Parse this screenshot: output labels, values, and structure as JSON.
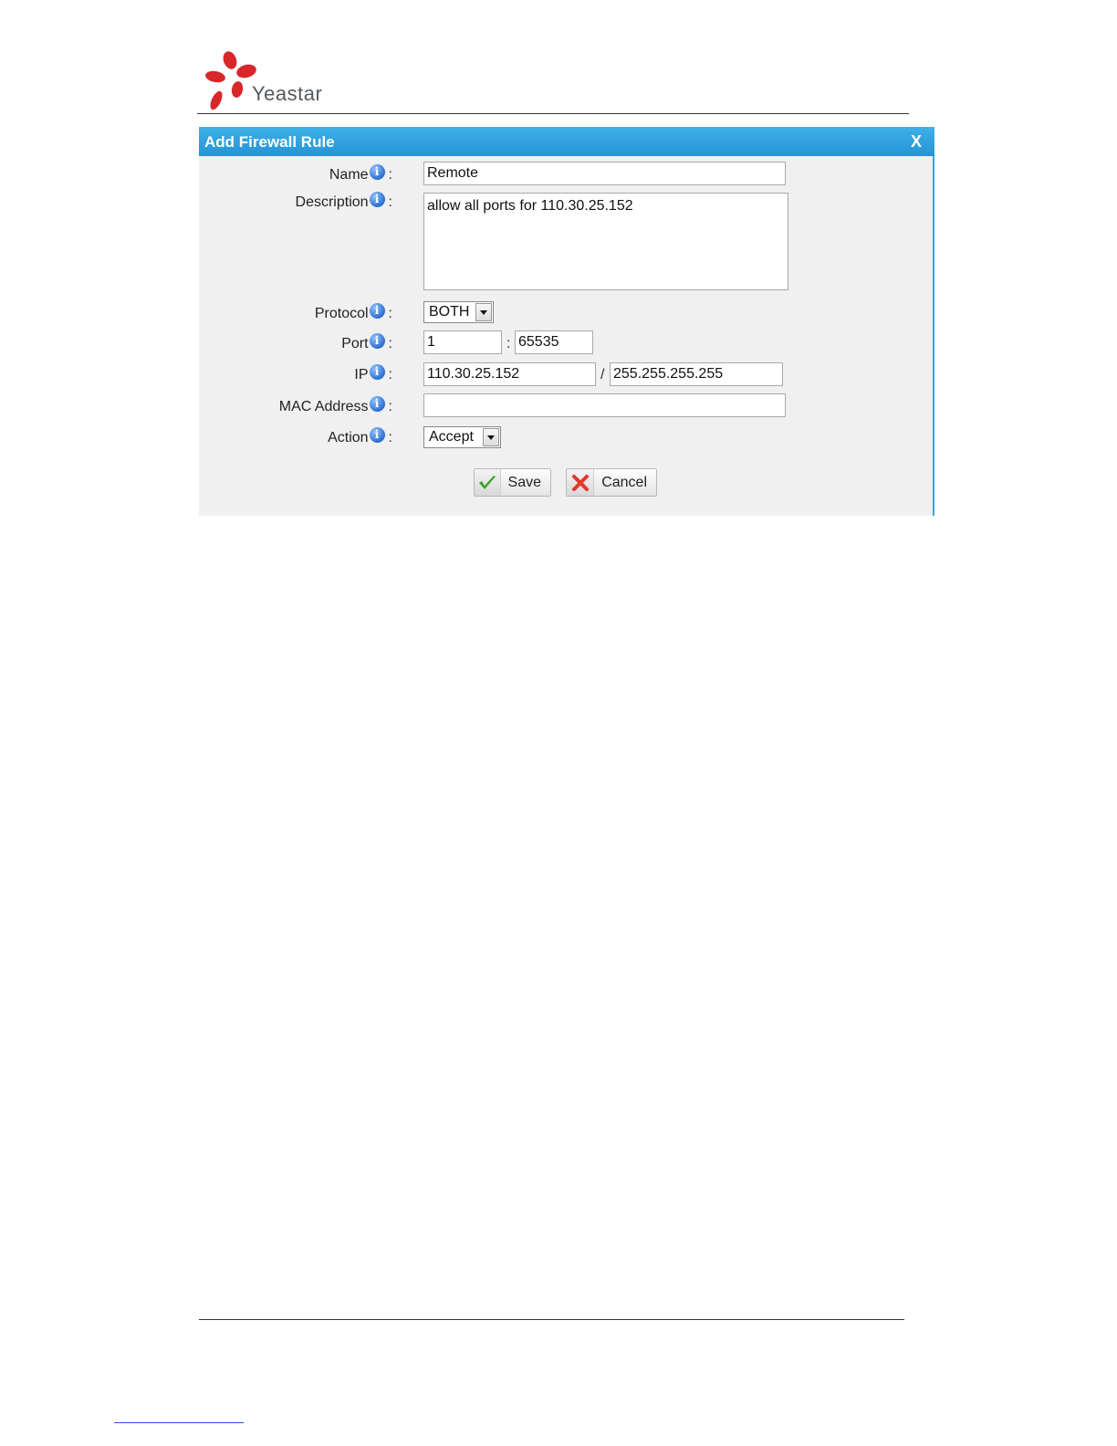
{
  "brand": {
    "name": "Yeastar"
  },
  "dialog": {
    "title": "Add Firewall Rule",
    "close_label": "X",
    "fields": {
      "name": {
        "label": "Name",
        "value": "Remote"
      },
      "description": {
        "label": "Description",
        "value": "allow all ports for 110.30.25.152"
      },
      "protocol": {
        "label": "Protocol",
        "value": "BOTH"
      },
      "port": {
        "label": "Port",
        "start": "1",
        "separator": ":",
        "end": "65535"
      },
      "ip": {
        "label": "IP",
        "address": "110.30.25.152",
        "separator": "/",
        "mask": "255.255.255.255"
      },
      "mac": {
        "label": "MAC Address",
        "value": ""
      },
      "action": {
        "label": "Action",
        "value": "Accept"
      }
    },
    "info_glyph": "i",
    "colon": ":",
    "buttons": {
      "save": "Save",
      "cancel": "Cancel"
    }
  },
  "colors": {
    "title_bar": "#2e9fdd",
    "dialog_bg": "#f0f0f0",
    "logo_red": "#d9262b"
  }
}
